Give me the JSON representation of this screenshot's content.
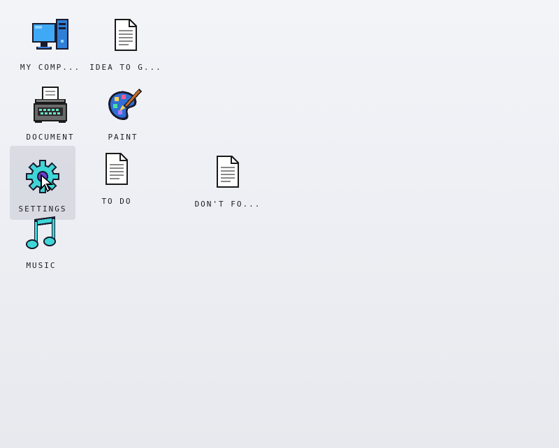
{
  "desktop": {
    "icons": [
      {
        "label": "MY COMP...",
        "icon": "computer-icon"
      },
      {
        "label": "IDEA TO G...",
        "icon": "document-file-icon"
      },
      {
        "label": "DOCUMENT",
        "icon": "typewriter-icon"
      },
      {
        "label": "PAINT",
        "icon": "paint-palette-icon"
      },
      {
        "label": "SETTINGS",
        "icon": "gear-icon"
      },
      {
        "label": "TO DO",
        "icon": "document-file-icon"
      },
      {
        "label": "DON'T FO...",
        "icon": "document-file-icon"
      },
      {
        "label": "MUSIC",
        "icon": "music-note-icon"
      }
    ],
    "selected_icon": "SETTINGS"
  },
  "colors": {
    "background": "#eef0f4",
    "selection": "#c8cbd4",
    "accent_teal": "#3ed6d6",
    "accent_blue": "#2a7fd4"
  }
}
